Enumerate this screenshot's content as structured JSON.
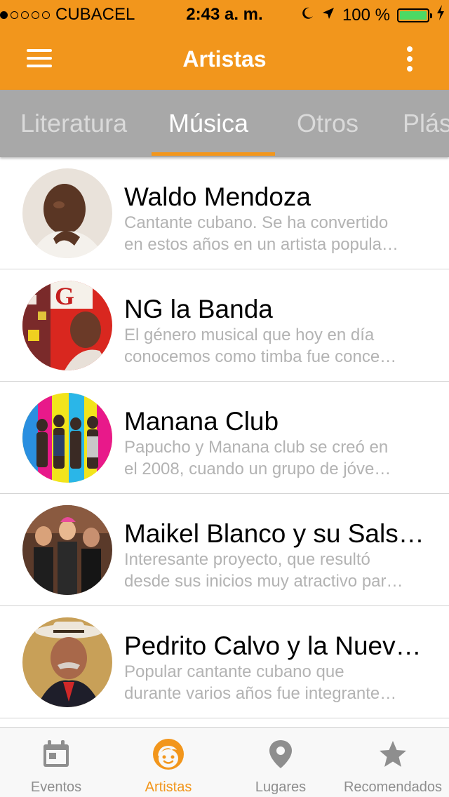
{
  "status_bar": {
    "carrier": "CUBACEL",
    "signal_filled_dots": 1,
    "signal_total_dots": 5,
    "time": "2:43 a. m.",
    "battery_text": "100 %",
    "battery_level": 1.0,
    "icons": [
      "moon-icon",
      "location-arrow-icon",
      "battery-icon",
      "charging-bolt-icon"
    ]
  },
  "app_bar": {
    "title": "Artistas",
    "left_icon": "hamburger-menu-icon",
    "right_icon": "more-vertical-icon"
  },
  "tabs": {
    "items": [
      "Literatura",
      "Música",
      "Otros",
      "Plás"
    ],
    "selected": "Música"
  },
  "artists": [
    {
      "name": "Waldo Mendoza",
      "desc_line1": "Cantante cubano. Se ha convertido",
      "desc_line2": "en estos años en un artista popula…"
    },
    {
      "name": "NG la Banda",
      "desc_line1": "El género musical que hoy en día",
      "desc_line2": "conocemos como timba fue conce…"
    },
    {
      "name": "Manana Club",
      "desc_line1": "Papucho y Manana club se creó en",
      "desc_line2": "el 2008, cuando un grupo de jóve…"
    },
    {
      "name": "Maikel Blanco y su Sals…",
      "desc_line1": "Interesante proyecto, que resultó",
      "desc_line2": "desde sus inicios muy atractivo par…"
    },
    {
      "name": "Pedrito Calvo y la Nuev…",
      "desc_line1": "Popular cantante cubano que",
      "desc_line2": "durante varios años fue integrante…"
    }
  ],
  "bottom_nav": {
    "items": [
      {
        "label": "Eventos",
        "icon": "calendar-icon"
      },
      {
        "label": "Artistas",
        "icon": "smiley-face-icon"
      },
      {
        "label": "Lugares",
        "icon": "map-pin-icon"
      },
      {
        "label": "Recomendados",
        "icon": "star-icon"
      }
    ],
    "selected": "Artistas"
  },
  "colors": {
    "accent": "#F2961C",
    "tab_bar_background": "#A8A8A8",
    "inactive_tab_text": "#DADADA",
    "description_text": "#B3B3B3",
    "inactive_nav": "#8E8E8E",
    "battery_fill": "#4CD964"
  }
}
